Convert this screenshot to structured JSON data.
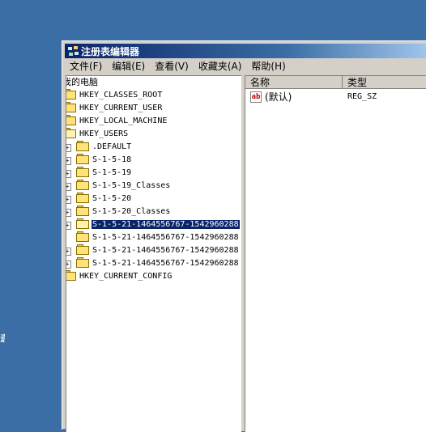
{
  "desktop": {
    "edge_glyph": "蠹"
  },
  "window": {
    "title": "注册表编辑器",
    "title_icon": "registry-editor-icon"
  },
  "menu": [
    "文件(F)",
    "编辑(E)",
    "查看(V)",
    "收藏夹(A)",
    "帮助(H)"
  ],
  "tree": {
    "root": "我的电脑",
    "keys": [
      "HKEY_CLASSES_ROOT",
      "HKEY_CURRENT_USER",
      "HKEY_LOCAL_MACHINE",
      "HKEY_USERS"
    ],
    "users": [
      ".DEFAULT",
      "S-1-5-18",
      "S-1-5-19",
      "S-1-5-19_Classes",
      "S-1-5-20",
      "S-1-5-20_Classes",
      "S-1-5-21-1464556767-1542960288",
      "S-1-5-21-1464556767-1542960288",
      "S-1-5-21-1464556767-1542960288",
      "S-1-5-21-1464556767-1542960288"
    ],
    "last_key": "HKEY_CURRENT_CONFIG",
    "selected_index": 6
  },
  "list": {
    "columns": {
      "name": "名称",
      "type": "类型"
    },
    "rows": [
      {
        "icon": "string-value-icon",
        "icon_text": "ab",
        "name": "(默认)",
        "type": "REG_SZ"
      }
    ]
  },
  "colors": {
    "desktop": "#3a6ea5",
    "title_active": "#0a246a",
    "selection": "#0a246a",
    "face": "#d4d0c8"
  }
}
